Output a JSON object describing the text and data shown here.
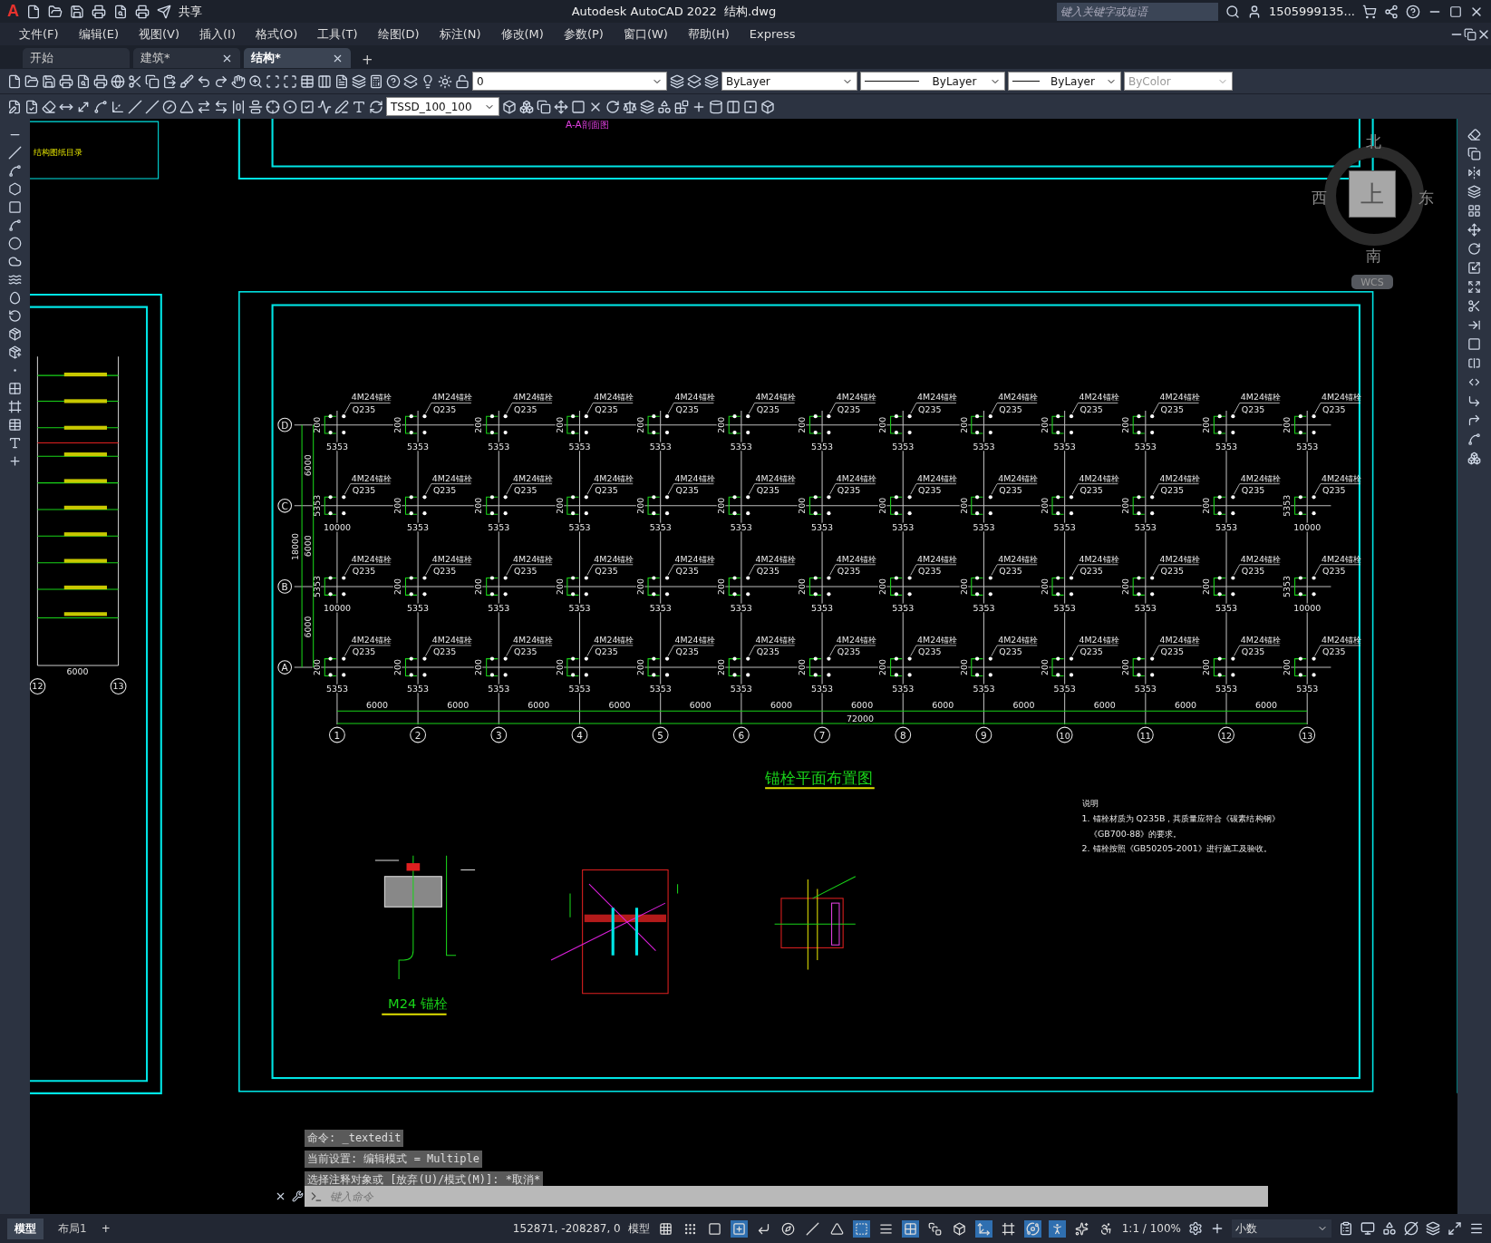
{
  "title_bar": {
    "logo": "A",
    "app": "Autodesk AutoCAD 2022",
    "file": "结构.dwg",
    "share": "共享",
    "search_placeholder": "键入关键字或短语",
    "user": "1505999135..."
  },
  "menu": [
    "文件(F)",
    "编辑(E)",
    "视图(V)",
    "插入(I)",
    "格式(O)",
    "工具(T)",
    "绘图(D)",
    "标注(N)",
    "修改(M)",
    "参数(P)",
    "窗口(W)",
    "帮助(H)",
    "Express"
  ],
  "file_tabs": [
    {
      "label": "开始",
      "closable": false,
      "selected": false
    },
    {
      "label": "建筑*",
      "closable": true,
      "selected": false
    },
    {
      "label": "结构*",
      "closable": true,
      "selected": true
    }
  ],
  "new_tab": "+",
  "toolbar": {
    "layer": "0",
    "dimstyle": "TSSD_100_100",
    "object_color": "ByLayer",
    "linetype": "ByLayer",
    "lineweight": "ByLayer",
    "plotstyle": "ByColor"
  },
  "viewcube": {
    "north": "北",
    "south": "南",
    "east": "东",
    "west": "西",
    "face": "上",
    "ucs": "WCS"
  },
  "sheet_top": {
    "index_title": "结构图纸目录",
    "section_title": "A-A剖面图"
  },
  "left_sheet": {
    "axes": [
      "12",
      "13"
    ],
    "dim": "6000"
  },
  "plan": {
    "title": "锚栓平面布置图",
    "columns": [
      "1",
      "2",
      "3",
      "4",
      "5",
      "6",
      "7",
      "8",
      "9",
      "10",
      "11",
      "12",
      "13"
    ],
    "spans": [
      "6000",
      "6000",
      "6000",
      "6000",
      "6000",
      "6000",
      "6000",
      "6000",
      "6000",
      "6000",
      "6000",
      "6000"
    ],
    "total": "72000",
    "row_spans": [
      "6000",
      "6000",
      "6000"
    ],
    "row_total": "18000",
    "rows": [
      {
        "axis": "D",
        "nodes": [
          {
            "bolt": "4M24锚栓",
            "grade": "Q235",
            "side": "200",
            "dim": "5353"
          },
          {
            "bolt": "4M24锚栓",
            "grade": "Q235",
            "side": "200",
            "dim": "5353"
          },
          {
            "bolt": "4M24锚栓",
            "grade": "Q235",
            "side": "200",
            "dim": "5353"
          },
          {
            "bolt": "4M24锚栓",
            "grade": "Q235",
            "side": "200",
            "dim": "5353"
          },
          {
            "bolt": "4M24锚栓",
            "grade": "Q235",
            "side": "200",
            "dim": "5353"
          },
          {
            "bolt": "4M24锚栓",
            "grade": "Q235",
            "side": "200",
            "dim": "5353"
          },
          {
            "bolt": "4M24锚栓",
            "grade": "Q235",
            "side": "200",
            "dim": "5353"
          },
          {
            "bolt": "4M24锚栓",
            "grade": "Q235",
            "side": "200",
            "dim": "5353"
          },
          {
            "bolt": "4M24锚栓",
            "grade": "Q235",
            "side": "200",
            "dim": "5353"
          },
          {
            "bolt": "4M24锚栓",
            "grade": "Q235",
            "side": "200",
            "dim": "5353"
          },
          {
            "bolt": "4M24锚栓",
            "grade": "Q235",
            "side": "200",
            "dim": "5353"
          },
          {
            "bolt": "4M24锚栓",
            "grade": "Q235",
            "side": "200",
            "dim": "5353"
          },
          {
            "bolt": "4M24锚栓",
            "grade": "Q235",
            "side": "200",
            "dim": "5353"
          }
        ]
      },
      {
        "axis": "C",
        "nodes": [
          {
            "bolt": "4M24锚栓",
            "grade": "Q235",
            "side": "5353",
            "dim": "10000"
          },
          {
            "bolt": "4M24锚栓",
            "grade": "Q235",
            "side": "200",
            "dim": "5353"
          },
          {
            "bolt": "4M24锚栓",
            "grade": "Q235",
            "side": "200",
            "dim": "5353"
          },
          {
            "bolt": "4M24锚栓",
            "grade": "Q235",
            "side": "200",
            "dim": "5353"
          },
          {
            "bolt": "4M24锚栓",
            "grade": "Q235",
            "side": "200",
            "dim": "5353"
          },
          {
            "bolt": "4M24锚栓",
            "grade": "Q235",
            "side": "200",
            "dim": "5353"
          },
          {
            "bolt": "4M24锚栓",
            "grade": "Q235",
            "side": "200",
            "dim": "5353"
          },
          {
            "bolt": "4M24锚栓",
            "grade": "Q235",
            "side": "200",
            "dim": "5353"
          },
          {
            "bolt": "4M24锚栓",
            "grade": "Q235",
            "side": "200",
            "dim": "5353"
          },
          {
            "bolt": "4M24锚栓",
            "grade": "Q235",
            "side": "200",
            "dim": "5353"
          },
          {
            "bolt": "4M24锚栓",
            "grade": "Q235",
            "side": "200",
            "dim": "5353"
          },
          {
            "bolt": "4M24锚栓",
            "grade": "Q235",
            "side": "200",
            "dim": "5353"
          },
          {
            "bolt": "4M24锚栓",
            "grade": "Q235",
            "side": "5353",
            "dim": "10000"
          }
        ]
      },
      {
        "axis": "B",
        "nodes": [
          {
            "bolt": "4M24锚栓",
            "grade": "Q235",
            "side": "5353",
            "dim": "10000"
          },
          {
            "bolt": "4M24锚栓",
            "grade": "Q235",
            "side": "200",
            "dim": "5353"
          },
          {
            "bolt": "4M24锚栓",
            "grade": "Q235",
            "side": "200",
            "dim": "5353"
          },
          {
            "bolt": "4M24锚栓",
            "grade": "Q235",
            "side": "200",
            "dim": "5353"
          },
          {
            "bolt": "4M24锚栓",
            "grade": "Q235",
            "side": "200",
            "dim": "5353"
          },
          {
            "bolt": "4M24锚栓",
            "grade": "Q235",
            "side": "200",
            "dim": "5353"
          },
          {
            "bolt": "4M24锚栓",
            "grade": "Q235",
            "side": "200",
            "dim": "5353"
          },
          {
            "bolt": "4M24锚栓",
            "grade": "Q235",
            "side": "200",
            "dim": "5353"
          },
          {
            "bolt": "4M24锚栓",
            "grade": "Q235",
            "side": "200",
            "dim": "5353"
          },
          {
            "bolt": "4M24锚栓",
            "grade": "Q235",
            "side": "200",
            "dim": "5353"
          },
          {
            "bolt": "4M24锚栓",
            "grade": "Q235",
            "side": "200",
            "dim": "5353"
          },
          {
            "bolt": "4M24锚栓",
            "grade": "Q235",
            "side": "200",
            "dim": "5353"
          },
          {
            "bolt": "4M24锚栓",
            "grade": "Q235",
            "side": "5353",
            "dim": "10000"
          }
        ]
      },
      {
        "axis": "A",
        "nodes": [
          {
            "bolt": "4M24锚栓",
            "grade": "Q235",
            "side": "200",
            "dim": "5353"
          },
          {
            "bolt": "4M24锚栓",
            "grade": "Q235",
            "side": "200",
            "dim": "5353"
          },
          {
            "bolt": "4M24锚栓",
            "grade": "Q235",
            "side": "200",
            "dim": "5353"
          },
          {
            "bolt": "4M24锚栓",
            "grade": "Q235",
            "side": "200",
            "dim": "5353"
          },
          {
            "bolt": "4M24锚栓",
            "grade": "Q235",
            "side": "200",
            "dim": "5353"
          },
          {
            "bolt": "4M24锚栓",
            "grade": "Q235",
            "side": "200",
            "dim": "5353"
          },
          {
            "bolt": "4M24锚栓",
            "grade": "Q235",
            "side": "200",
            "dim": "5353"
          },
          {
            "bolt": "4M24锚栓",
            "grade": "Q235",
            "side": "200",
            "dim": "5353"
          },
          {
            "bolt": "4M24锚栓",
            "grade": "Q235",
            "side": "200",
            "dim": "5353"
          },
          {
            "bolt": "4M24锚栓",
            "grade": "Q235",
            "side": "200",
            "dim": "5353"
          },
          {
            "bolt": "4M24锚栓",
            "grade": "Q235",
            "side": "200",
            "dim": "5353"
          },
          {
            "bolt": "4M24锚栓",
            "grade": "Q235",
            "side": "200",
            "dim": "5353"
          },
          {
            "bolt": "4M24锚栓",
            "grade": "Q235",
            "side": "200",
            "dim": "5353"
          }
        ]
      }
    ]
  },
  "notes": {
    "heading": "说明",
    "lines": [
      "1. 锚栓材质为 Q235B，其质量应符合《碳素结构钢》",
      "《GB700-88》的要求。",
      "2. 锚栓按照《GB50205-2001》进行施工及验收。"
    ]
  },
  "bolt_detail": {
    "title": "M24 锚栓"
  },
  "command": {
    "history": [
      "命令: _textedit",
      "当前设置: 编辑模式 = Multiple",
      "选择注释对象或 [放弃(U)/模式(M)]: *取消*"
    ],
    "placeholder": "键入命令"
  },
  "layout_tabs": [
    {
      "label": "模型",
      "selected": true
    },
    {
      "label": "布局1",
      "selected": false
    }
  ],
  "new_layout": "+",
  "status_bar": {
    "coords": "152871, -208287, 0",
    "space": "模型",
    "scale": "1:1 / 100%",
    "units": "小数"
  }
}
